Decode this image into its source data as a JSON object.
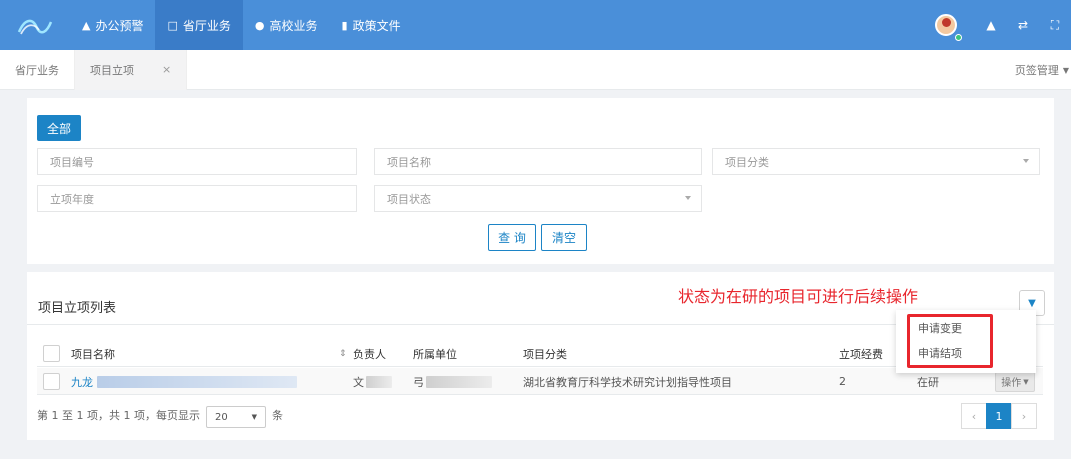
{
  "topnav": {
    "items": [
      {
        "label": "办公预警",
        "icon": "bell-icon"
      },
      {
        "label": "省厅业务",
        "icon": "monitor-icon"
      },
      {
        "label": "高校业务",
        "icon": "cloud-icon"
      },
      {
        "label": "政策文件",
        "icon": "file-icon"
      }
    ],
    "right_icons": [
      "bell-icon",
      "shuffle-icon",
      "fullscreen-icon"
    ],
    "bg_color": "#4a8fd9",
    "active_color": "#3a7cc8"
  },
  "tabs": {
    "items": [
      {
        "label": "省厅业务"
      },
      {
        "label": "项目立项"
      }
    ],
    "close_glyph": "×",
    "manage_label": "页签管理"
  },
  "search": {
    "all_button": "全部",
    "fields": {
      "project_no": "项目编号",
      "project_name": "项目名称",
      "project_category": "项目分类",
      "year": "立项年度",
      "status": "项目状态"
    },
    "query_button": "查 询",
    "clear_button": "清空"
  },
  "list": {
    "title": "项目立项列表",
    "annotation": "状态为在研的项目可进行后续操作",
    "columns": {
      "name": "项目名称",
      "leader": "负责人",
      "unit": "所属单位",
      "category": "项目分类",
      "funding": "立项经费",
      "status": "状态"
    },
    "row": {
      "name_prefix": "九龙",
      "leader_prefix": "文",
      "unit_prefix": "弓",
      "category": "湖北省教育厅科学技术研究计划指导性项目",
      "funding": "2",
      "status": "在研",
      "ops": "操作"
    },
    "dropdown": {
      "items": [
        "申请变更",
        "申请结项"
      ]
    },
    "sort_glyph": "⇕",
    "accent_color": "#1c84c6",
    "highlight_color": "#e8262d"
  },
  "footer": {
    "summary": "第 1 至 1 项，共 1 项，每页显示",
    "page_size": "20",
    "unit": "条",
    "prev": "‹",
    "current_page": "1",
    "next": "›"
  }
}
